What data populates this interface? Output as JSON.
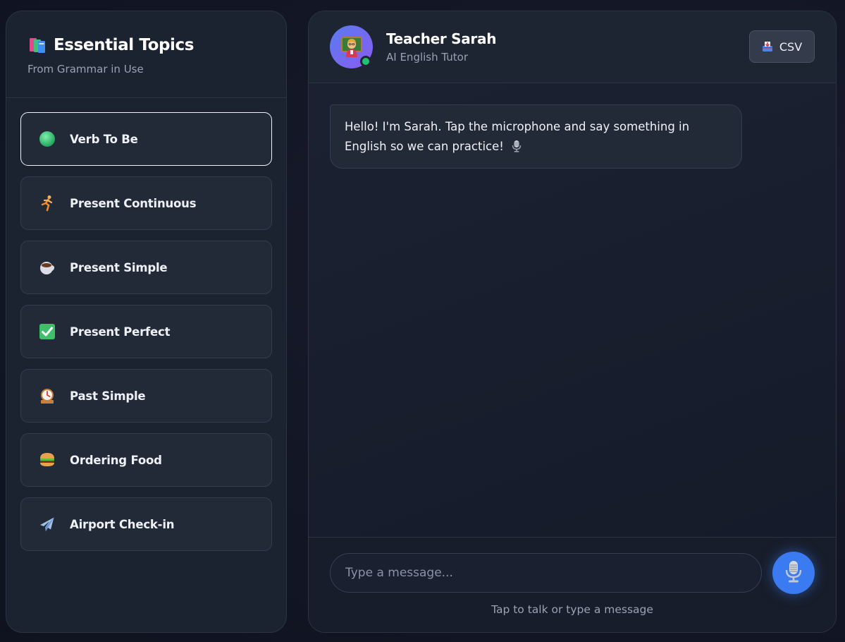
{
  "sidebar": {
    "title": "Essential Topics",
    "title_icon": "books-icon",
    "subtitle": "From Grammar in Use",
    "items": [
      {
        "label": "Verb To Be",
        "icon": "green-circle-icon",
        "active": true
      },
      {
        "label": "Present Continuous",
        "icon": "running-person-icon",
        "active": false
      },
      {
        "label": "Present Simple",
        "icon": "coffee-cup-icon",
        "active": false
      },
      {
        "label": "Present Perfect",
        "icon": "check-mark-icon",
        "active": false
      },
      {
        "label": "Past Simple",
        "icon": "mantel-clock-icon",
        "active": false
      },
      {
        "label": "Ordering Food",
        "icon": "hamburger-icon",
        "active": false
      },
      {
        "label": "Airport Check-in",
        "icon": "airplane-icon",
        "active": false
      }
    ]
  },
  "chat": {
    "tutor_name": "Teacher Sarah",
    "tutor_role": "AI English Tutor",
    "avatar_icon": "teacher-avatar-icon",
    "csv_label": "CSV",
    "messages": [
      {
        "from": "tutor",
        "text": "Hello! I'm Sarah. Tap the microphone and say something in English so we can practice!"
      }
    ],
    "input_placeholder": "Type a message...",
    "hint": "Tap to talk or type a message"
  },
  "colors": {
    "accent": "#3b7bf2",
    "online": "#22c06f",
    "panel": "#1b2230"
  }
}
